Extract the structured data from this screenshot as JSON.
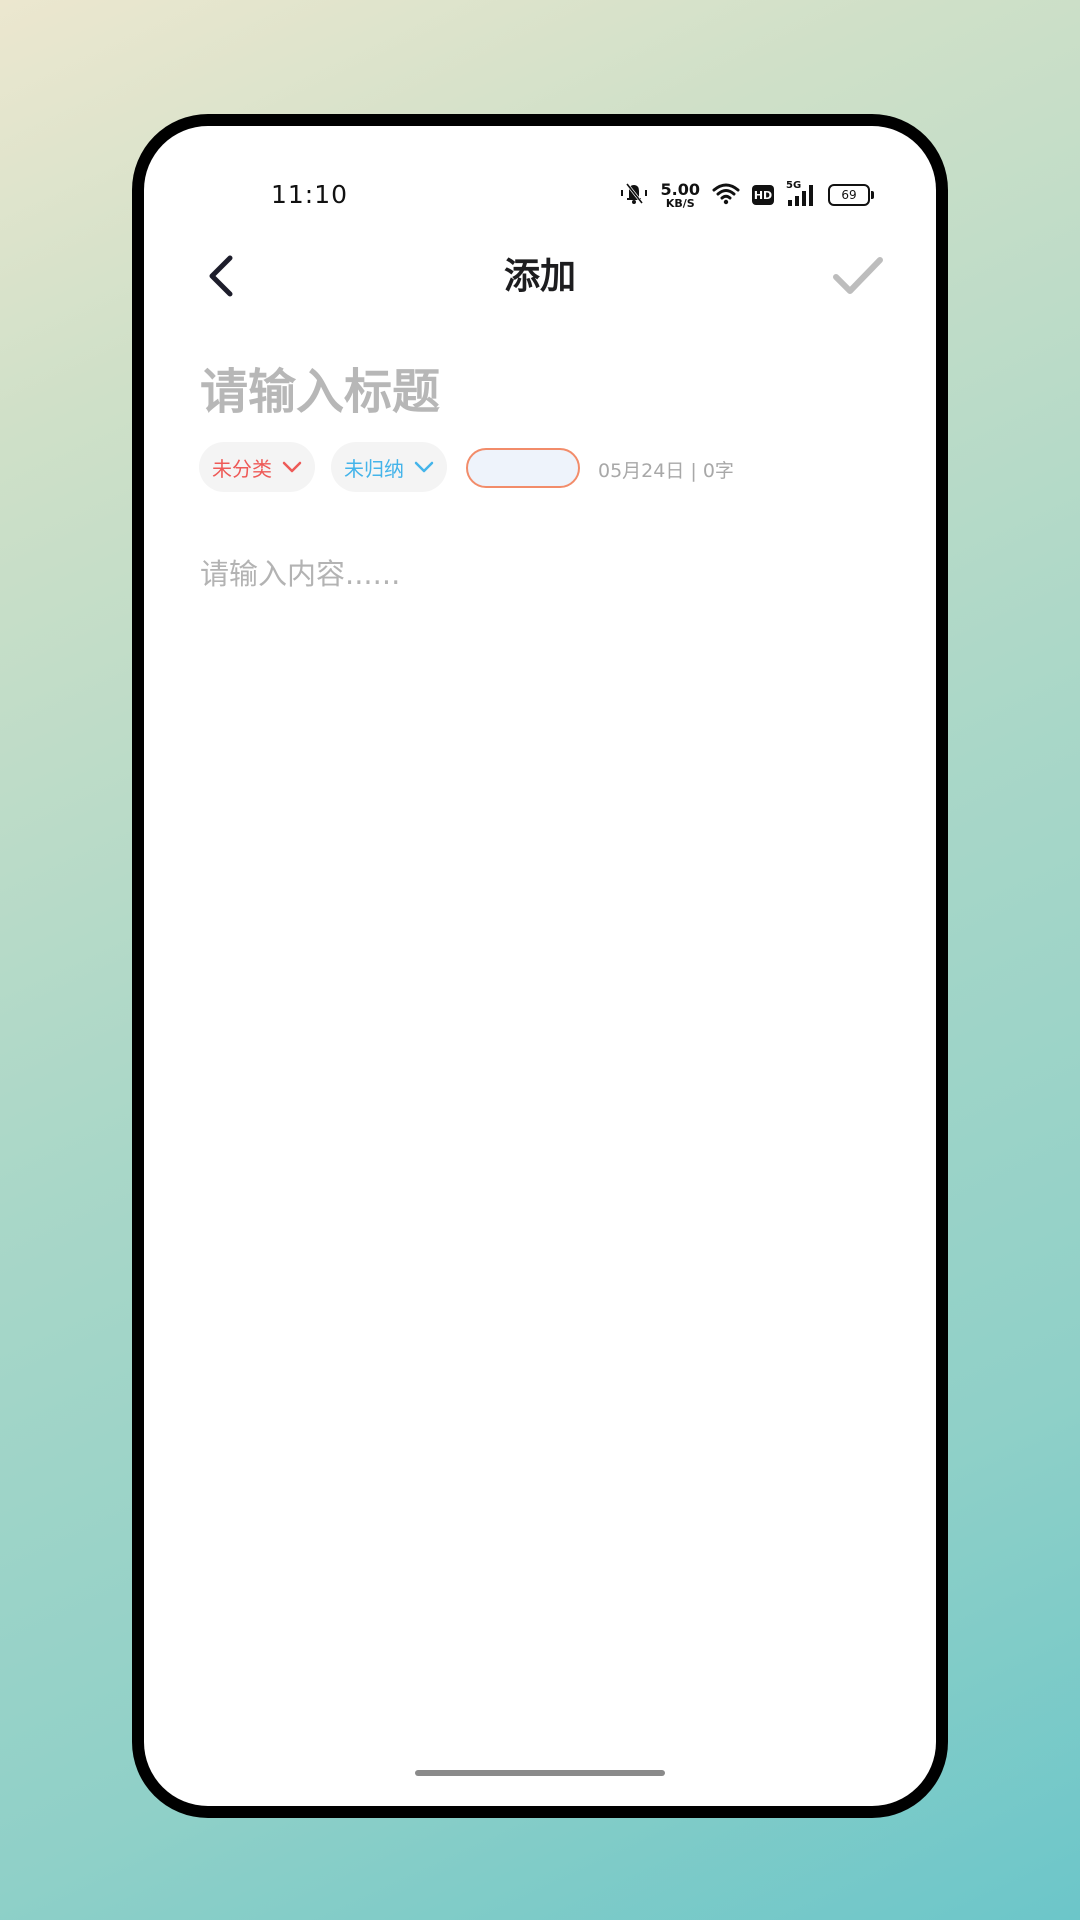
{
  "status_bar": {
    "time": "11:10",
    "network_speed_value": "5.00",
    "network_speed_unit": "KB/S",
    "hd_label": "HD",
    "network_type": "5G",
    "battery_level": "69"
  },
  "header": {
    "title": "添加"
  },
  "title_input": {
    "placeholder": "请输入标题",
    "value": ""
  },
  "meta_row": {
    "category_label": "未分类",
    "archive_label": "未归纳",
    "tag_value": "",
    "date_and_count": "05月24日 | 0字"
  },
  "content_input": {
    "placeholder": "请输入内容......",
    "value": ""
  },
  "colors": {
    "category": "#ee5a57",
    "archive": "#44b4ea",
    "tag_border": "#f28c6a",
    "confirm_disabled": "#bdbdbd"
  },
  "icons": [
    "mute-icon",
    "wifi-icon",
    "signal-icon",
    "battery-icon",
    "back-chevron-icon",
    "check-icon",
    "chevron-down-icon"
  ]
}
